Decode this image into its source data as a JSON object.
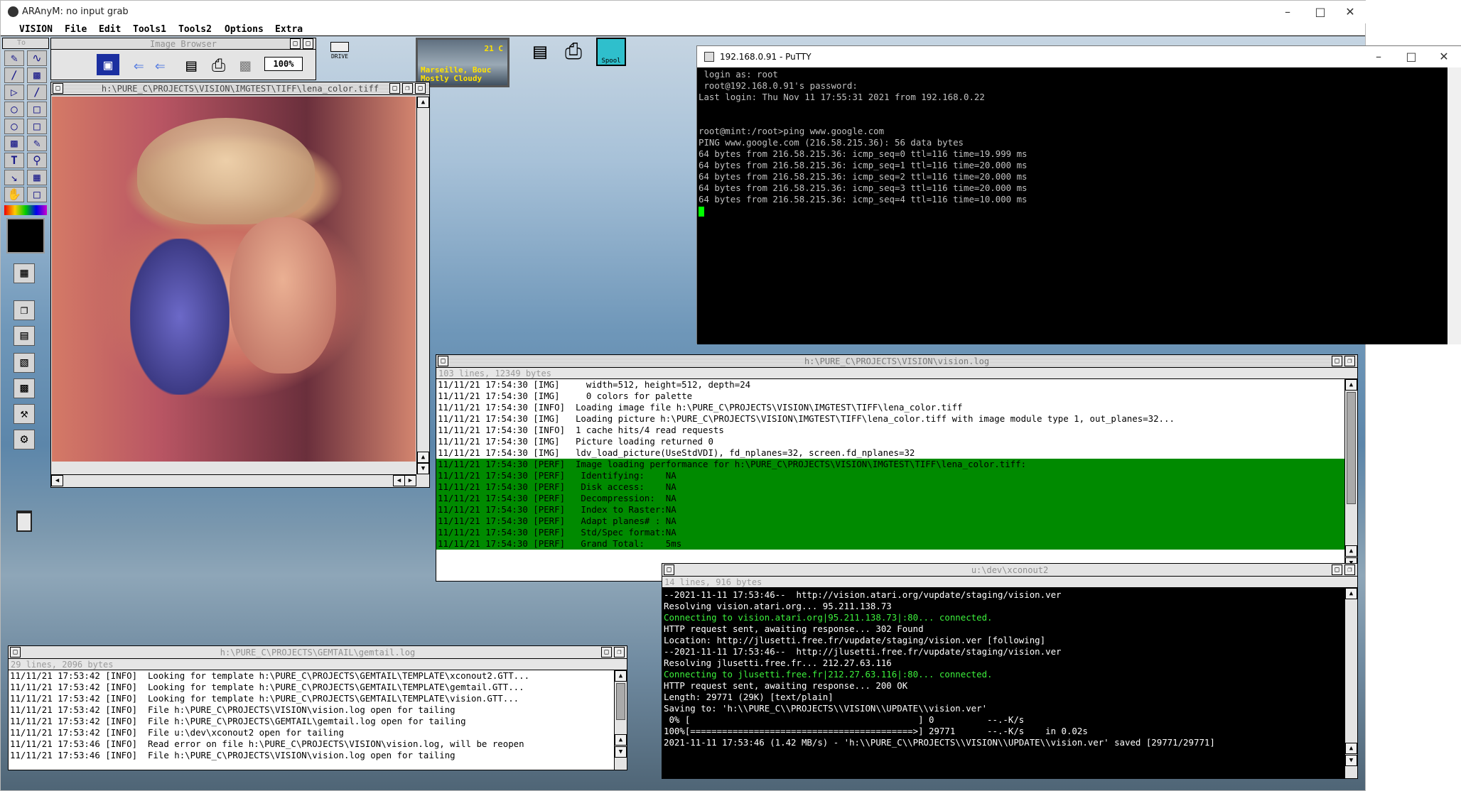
{
  "host_window": {
    "title": "ARAnyM: no input grab"
  },
  "menubar": [
    "VISION",
    "File",
    "Edit",
    "Tools1",
    "Tools2",
    "Options",
    "Extra"
  ],
  "image_browser": {
    "title": "Image Browser",
    "zoom": "100%"
  },
  "drive_icon": "DRIVE",
  "weather": {
    "temp": "21 C",
    "line1": "Marseille, Bouc",
    "line2": "Mostly Cloudy"
  },
  "spool_icon": "Spool",
  "lena_window": {
    "title": "h:\\PURE_C\\PROJECTS\\VISION\\IMGTEST\\TIFF\\lena_color.tiff"
  },
  "putty": {
    "title": "192.168.0.91 - PuTTY",
    "lines": [
      " login as: root",
      " root@192.168.0.91's password:",
      "Last login: Thu Nov 11 17:55:31 2021 from 192.168.0.22",
      "",
      "",
      "root@mint:/root>ping www.google.com",
      "PING www.google.com (216.58.215.36): 56 data bytes",
      "64 bytes from 216.58.215.36: icmp_seq=0 ttl=116 time=19.999 ms",
      "64 bytes from 216.58.215.36: icmp_seq=1 ttl=116 time=20.000 ms",
      "64 bytes from 216.58.215.36: icmp_seq=2 ttl=116 time=20.000 ms",
      "64 bytes from 216.58.215.36: icmp_seq=3 ttl=116 time=20.000 ms",
      "64 bytes from 216.58.215.36: icmp_seq=4 ttl=116 time=10.000 ms"
    ]
  },
  "vision_log": {
    "title": "h:\\PURE_C\\PROJECTS\\VISION\\vision.log",
    "info": "103 lines, 12349 bytes",
    "lines": [
      {
        "t": "11/11/21 17:54:30 [IMG]     width=512, height=512, depth=24",
        "hl": false
      },
      {
        "t": "11/11/21 17:54:30 [IMG]     0 colors for palette",
        "hl": false
      },
      {
        "t": "11/11/21 17:54:30 [INFO]  Loading image file h:\\PURE_C\\PROJECTS\\VISION\\IMGTEST\\TIFF\\lena_color.tiff",
        "hl": false
      },
      {
        "t": "11/11/21 17:54:30 [IMG]   Loading picture h:\\PURE_C\\PROJECTS\\VISION\\IMGTEST\\TIFF\\lena_color.tiff with image module type 1, out_planes=32...",
        "hl": false
      },
      {
        "t": "11/11/21 17:54:30 [INFO]  1 cache hits/4 read requests",
        "hl": false
      },
      {
        "t": "11/11/21 17:54:30 [IMG]   Picture loading returned 0",
        "hl": false
      },
      {
        "t": "11/11/21 17:54:30 [IMG]   ldv_load_picture(UseStdVDI), fd_nplanes=32, screen.fd_nplanes=32",
        "hl": false
      },
      {
        "t": "11/11/21 17:54:30 [PERF]  Image loading performance for h:\\PURE_C\\PROJECTS\\VISION\\IMGTEST\\TIFF\\lena_color.tiff:",
        "hl": true
      },
      {
        "t": "11/11/21 17:54:30 [PERF]   Identifying:    NA",
        "hl": true
      },
      {
        "t": "11/11/21 17:54:30 [PERF]   Disk access:    NA",
        "hl": true
      },
      {
        "t": "11/11/21 17:54:30 [PERF]   Decompression:  NA",
        "hl": true
      },
      {
        "t": "11/11/21 17:54:30 [PERF]   Index to Raster:NA",
        "hl": true
      },
      {
        "t": "11/11/21 17:54:30 [PERF]   Adapt planes# : NA",
        "hl": true
      },
      {
        "t": "11/11/21 17:54:30 [PERF]   Std/Spec format:NA",
        "hl": true
      },
      {
        "t": "11/11/21 17:54:30 [PERF]   Grand Total:    5ms",
        "hl": true
      }
    ]
  },
  "xconout_log": {
    "title": "u:\\dev\\xconout2",
    "info": "14 lines, 916 bytes",
    "lines": [
      {
        "t": "--2021-11-11 17:53:46--  http://vision.atari.org/vupdate/staging/vision.ver",
        "c": "w"
      },
      {
        "t": "Resolving vision.atari.org... 95.211.138.73",
        "c": "w"
      },
      {
        "t": "Connecting to vision.atari.org|95.211.138.73|:80... connected.",
        "c": "g"
      },
      {
        "t": "HTTP request sent, awaiting response... 302 Found",
        "c": "w"
      },
      {
        "t": "Location: http://jlusetti.free.fr/vupdate/staging/vision.ver [following]",
        "c": "w"
      },
      {
        "t": "--2021-11-11 17:53:46--  http://jlusetti.free.fr/vupdate/staging/vision.ver",
        "c": "w"
      },
      {
        "t": "Resolving jlusetti.free.fr... 212.27.63.116",
        "c": "w"
      },
      {
        "t": "Connecting to jlusetti.free.fr|212.27.63.116|:80... connected.",
        "c": "g"
      },
      {
        "t": "HTTP request sent, awaiting response... 200 OK",
        "c": "w"
      },
      {
        "t": "Length: 29771 (29K) [text/plain]",
        "c": "w"
      },
      {
        "t": "Saving to: 'h:\\\\PURE_C\\\\PROJECTS\\\\VISION\\\\UPDATE\\\\vision.ver'",
        "c": "w"
      },
      {
        "t": " 0% [                                           ] 0          --.-K/s",
        "c": "w"
      },
      {
        "t": "100%[==========================================>] 29771      --.-K/s    in 0.02s",
        "c": "w"
      },
      {
        "t": "2021-11-11 17:53:46 (1.42 MB/s) - 'h:\\\\PURE_C\\\\PROJECTS\\\\VISION\\\\UPDATE\\\\vision.ver' saved [29771/29771]",
        "c": "w"
      }
    ]
  },
  "gemtail_log": {
    "title": "h:\\PURE_C\\PROJECTS\\GEMTAIL\\gemtail.log",
    "info": "29 lines, 2096 bytes",
    "lines": [
      "11/11/21 17:53:42 [INFO]  Looking for template h:\\PURE_C\\PROJECTS\\GEMTAIL\\TEMPLATE\\xconout2.GTT...",
      "11/11/21 17:53:42 [INFO]  Looking for template h:\\PURE_C\\PROJECTS\\GEMTAIL\\TEMPLATE\\gemtail.GTT...",
      "11/11/21 17:53:42 [INFO]  Looking for template h:\\PURE_C\\PROJECTS\\GEMTAIL\\TEMPLATE\\vision.GTT...",
      "11/11/21 17:53:42 [INFO]  File h:\\PURE_C\\PROJECTS\\VISION\\vision.log open for tailing",
      "11/11/21 17:53:42 [INFO]  File h:\\PURE_C\\PROJECTS\\GEMTAIL\\gemtail.log open for tailing",
      "11/11/21 17:53:42 [INFO]  File u:\\dev\\xconout2 open for tailing",
      "11/11/21 17:53:46 [INFO]  Read error on file h:\\PURE_C\\PROJECTS\\VISION\\vision.log, will be reopen",
      "11/11/21 17:53:46 [INFO]  File h:\\PURE_C\\PROJECTS\\VISION\\vision.log open for tailing"
    ]
  },
  "colors": {
    "highlight": "#008a00",
    "term_green": "#3cf03c",
    "desktop": "#6f97b9"
  }
}
